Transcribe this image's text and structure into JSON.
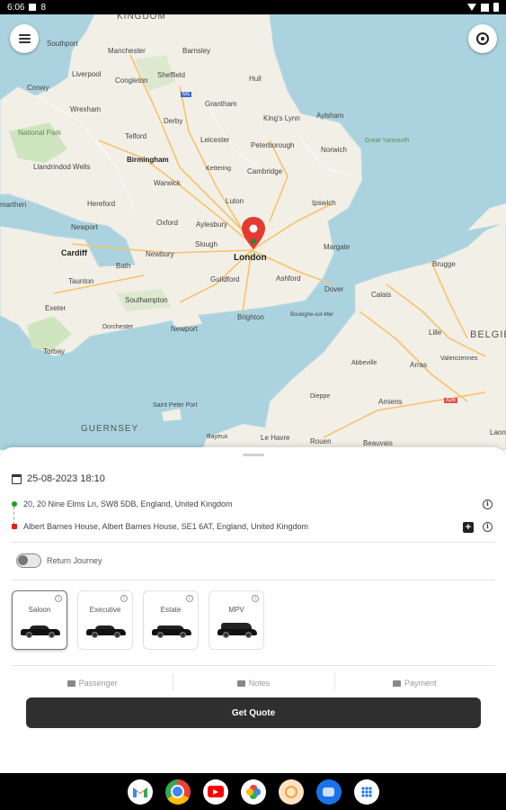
{
  "status_bar": {
    "time": "6:06",
    "indicator": "8"
  },
  "map": {
    "labels": {
      "kingdom": "KINGDOM",
      "southport": "Southport",
      "manchester": "Manchester",
      "sheffield": "Sheffield",
      "barnsley": "Barnsley",
      "liverpool": "Liverpool",
      "congleton": "Congleton",
      "m1": "M1",
      "conwy": "Conwy",
      "hull": "Hull",
      "wrexham": "Wrexham",
      "grantham": "Grantham",
      "aylsham": "Aylsham",
      "national_park": "National Park",
      "derby": "Derby",
      "kings_lynn": "King's Lynn",
      "telford": "Telford",
      "leicester": "Leicester",
      "peterborough": "Peterborough",
      "norwich": "Norwich",
      "great_yarmouth": "Great Yarmouth",
      "birmingham": "Birmingham",
      "llandrindod": "Llandrindod Wells",
      "kettering": "Kettering",
      "cambridge": "Cambridge",
      "warwick": "Warwick",
      "ipswich": "Ipswich",
      "narthen": "marthen",
      "hereford": "Hereford",
      "luton": "Luton",
      "oxford": "Oxford",
      "aylesbury": "Aylesbury",
      "newport": "Newport",
      "slough": "Slough",
      "margate": "Margate",
      "cardiff": "Cardiff",
      "newbury": "Newbury",
      "london": "London",
      "bath": "Bath",
      "ashford": "Ashford",
      "brugge": "Brugge",
      "taunton": "Taunton",
      "guildford": "Guildford",
      "dover": "Dover",
      "calais": "Calais",
      "southampton": "Southampton",
      "brighton": "Brighton",
      "boulogne": "Boulogne-sur-Mer",
      "exeter": "Exeter",
      "dorchester": "Dorchester",
      "newport_iow": "Newport",
      "lille": "Lille",
      "belgique": "BELGIË",
      "torbay": "Torbay",
      "arras": "Arras",
      "valenciennes": "Valenciennes",
      "abbeville": "Abbeville",
      "dieppe": "Dieppe",
      "amiens": "Amiens",
      "a26": "A26",
      "guernsey": "GUERNSEY",
      "saint_peter_port": "Saint Peter Port",
      "le_havre": "Le Havre",
      "rouen": "Rouen",
      "beauvais": "Beauvais",
      "bayeux": "Bayeux",
      "laon": "Laon"
    }
  },
  "booking": {
    "datetime": "25-08-2023 18:10",
    "pickup": "20, 20 Nine Elms Ln, SW8 5DB, England,  United Kingdom",
    "dropoff": "Albert Barnes House, Albert Barnes House, SE1 6AT, England,  United Kingdom",
    "return_journey_label": "Return Journey",
    "return_journey_on": false,
    "vehicles": [
      {
        "name": "Saloon",
        "selected": true
      },
      {
        "name": "Executive",
        "selected": false
      },
      {
        "name": "Estate",
        "selected": false
      },
      {
        "name": "MPV",
        "selected": false
      }
    ],
    "tabs": {
      "passenger": "Passenger",
      "notes": "Notes",
      "payment": "Payment"
    },
    "get_quote_label": "Get Quote"
  },
  "dock": {
    "apps": [
      "gmail-icon",
      "chrome-icon",
      "youtube-icon",
      "photos-icon",
      "app5-icon",
      "messages-icon",
      "app-drawer-icon"
    ],
    "colors": {
      "gmail": "#ffffff",
      "chrome": "#4285f4",
      "youtube": "#ff0000",
      "photos": "#ffffff",
      "app5": "#f4a340",
      "messages": "#1a73e8",
      "drawer": "#ffffff"
    }
  }
}
